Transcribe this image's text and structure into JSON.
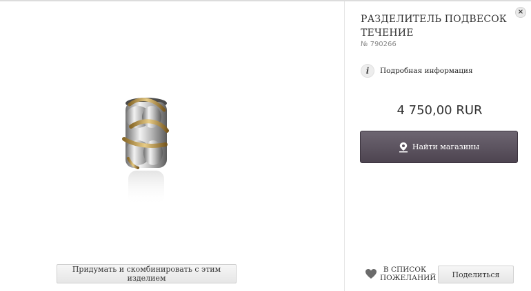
{
  "product": {
    "title": "РАЗДЕЛИТЕЛЬ ПОДВЕСОК ТЕЧЕНИЕ",
    "sku": "№ 790266",
    "price": "4 750,00 RUR",
    "image_icon": "charm-spacer-image"
  },
  "info": {
    "icon": "i",
    "label": "Подробная информация"
  },
  "actions": {
    "find_stores_label": "Найти магазины",
    "combine_label": "Придумать и скомбинировать с этим изделием",
    "wishlist_label": "В СПИСОК ПОЖЕЛАНИЙ",
    "share_label": "Поделиться",
    "close_label": "×"
  },
  "colors": {
    "button_dark": "#5a515d",
    "silver": "#c8c8c8",
    "gold": "#c9a45c",
    "heart": "#6b6b6b"
  }
}
